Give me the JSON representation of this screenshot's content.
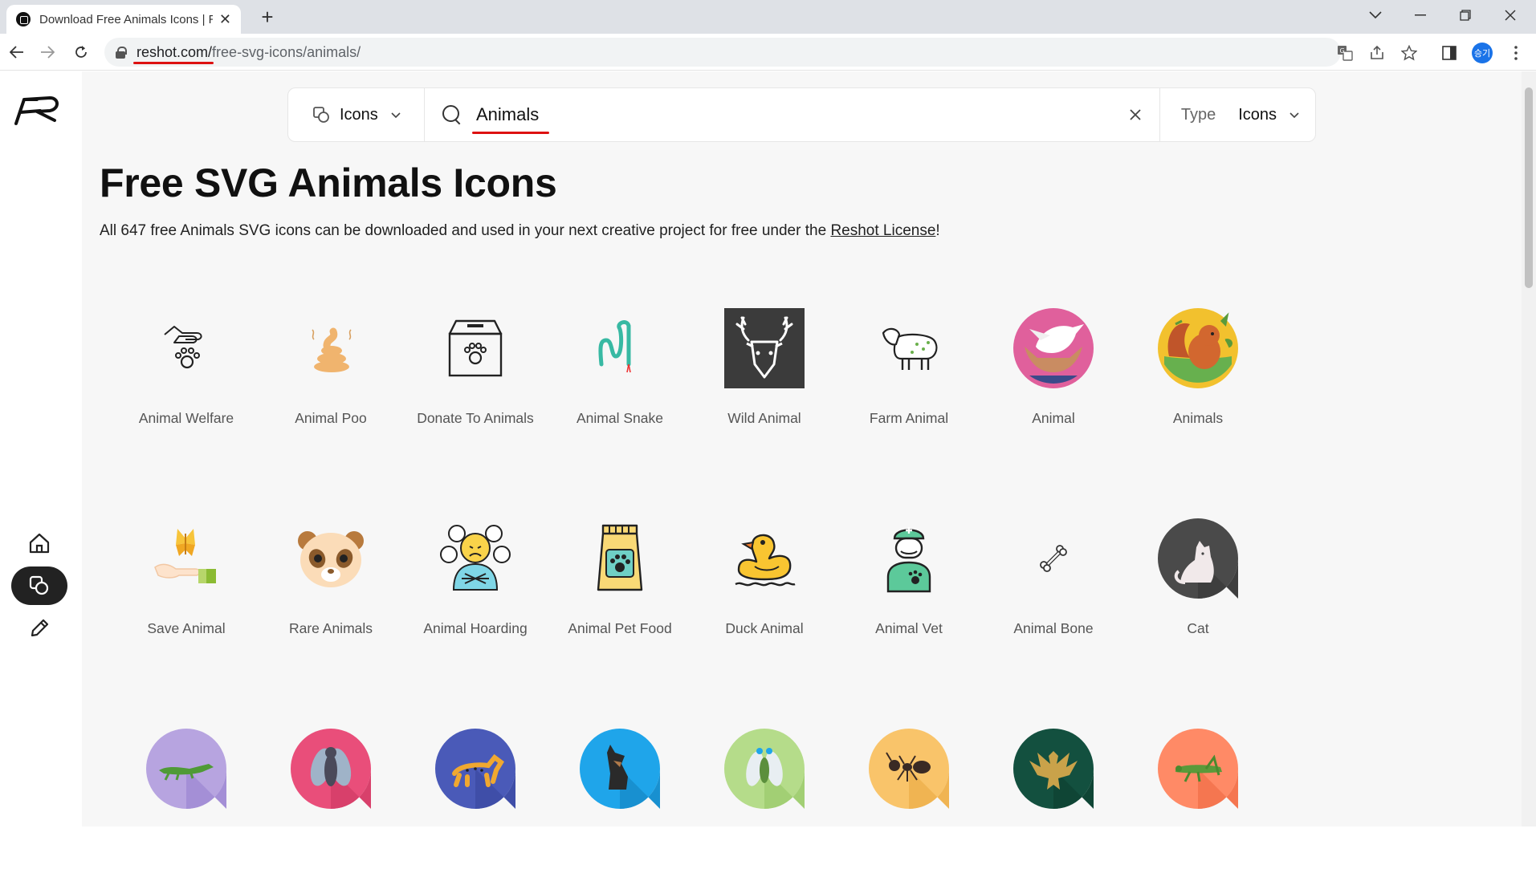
{
  "browser": {
    "tab_title": "Download Free Animals Icons | R",
    "tab_close": "✕",
    "new_tab": "+",
    "url_host": "reshot.com/",
    "url_path": "free-svg-icons/animals/",
    "profile_initials": "승기"
  },
  "search": {
    "type_label": "Icons",
    "query": "Animals",
    "clear": "✕",
    "filter_label": "Type",
    "filter_value": "Icons"
  },
  "heading": "Free SVG Animals Icons",
  "description": {
    "text": "All 647 free Animals SVG icons can be downloaded and used in your next creative project for free under the ",
    "link": "Reshot License",
    "end": "!"
  },
  "icons": [
    {
      "name": "Animal Welfare",
      "icon": "hand-paw-icon"
    },
    {
      "name": "Animal Poo",
      "icon": "poo-icon"
    },
    {
      "name": "Donate To Animals",
      "icon": "donation-box-icon"
    },
    {
      "name": "Animal Snake",
      "icon": "snake-icon"
    },
    {
      "name": "Wild Animal",
      "icon": "deer-icon"
    },
    {
      "name": "Farm Animal",
      "icon": "sheep-icon"
    },
    {
      "name": "Animal",
      "icon": "dove-hands-icon"
    },
    {
      "name": "Animals",
      "icon": "squirrel-icon"
    },
    {
      "name": "Save Animal",
      "icon": "butterfly-hand-icon"
    },
    {
      "name": "Rare Animals",
      "icon": "red-panda-icon"
    },
    {
      "name": "Animal Hoarding",
      "icon": "hoarder-icon"
    },
    {
      "name": "Animal Pet Food",
      "icon": "pet-food-bag-icon"
    },
    {
      "name": "Duck Animal",
      "icon": "duck-icon"
    },
    {
      "name": "Animal Vet",
      "icon": "veterinarian-icon"
    },
    {
      "name": "Animal Bone",
      "icon": "bone-icon"
    },
    {
      "name": "Cat",
      "icon": "cat-icon"
    },
    {
      "name": "",
      "icon": "crocodile-icon"
    },
    {
      "name": "",
      "icon": "fly-icon"
    },
    {
      "name": "",
      "icon": "leopard-icon"
    },
    {
      "name": "",
      "icon": "dog-icon"
    },
    {
      "name": "",
      "icon": "insect-icon"
    },
    {
      "name": "",
      "icon": "ant-icon"
    },
    {
      "name": "",
      "icon": "eagle-icon"
    },
    {
      "name": "",
      "icon": "grasshopper-icon"
    }
  ],
  "colors": {
    "accent_underline": "#dd1111",
    "page_bg": "#f7f7f7",
    "active_nav": "#222222"
  }
}
